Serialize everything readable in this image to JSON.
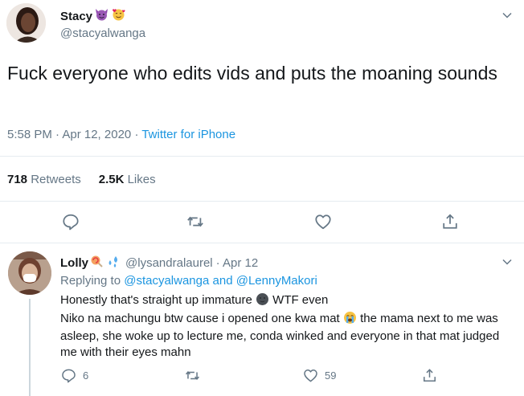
{
  "tweet": {
    "author": {
      "display_name": "Stacy",
      "name_emojis": [
        "smiling-imp-emoji",
        "smiling-face-with-hearts-emoji"
      ],
      "handle": "@stacyalwanga"
    },
    "text": "Fuck everyone who edits vids and puts the moaning sounds",
    "time": "5:58 PM · Apr 12, 2020",
    "separator": "·",
    "source": "Twitter for iPhone",
    "stats": {
      "retweets_count": "718",
      "retweets_label": "Retweets",
      "likes_count": "2.5K",
      "likes_label": "Likes"
    },
    "actions": [
      "reply-icon",
      "retweet-icon",
      "like-icon",
      "share-icon"
    ]
  },
  "reply": {
    "author": {
      "display_name": "Lolly",
      "name_emojis": [
        "lollipop-emoji",
        "sweat-droplets-emoji"
      ],
      "handle": "@lysandralaurel",
      "date": "· Apr 12"
    },
    "replying_to_label": "Replying to",
    "replying_to_user1": "@stacyalwanga",
    "replying_to_and": "and",
    "replying_to_user2": "@LennyMakori",
    "line1_a": "Honestly that's straight up immature",
    "line1_b": "WTF even",
    "line2_a": "Niko na machungu btw cause i opened one kwa mat",
    "line2_b": "the mama next to me was asleep, she woke up to lecture me, conda winked and everyone in that mat judged me with their eyes mahn",
    "counts": {
      "replies": "6",
      "likes": "59"
    },
    "actions": [
      "reply-icon",
      "retweet-icon",
      "like-icon",
      "share-icon"
    ]
  },
  "colors": {
    "link": "#1b95e0",
    "muted": "#657786",
    "text": "#14171a",
    "divider": "#e6ecf0"
  }
}
